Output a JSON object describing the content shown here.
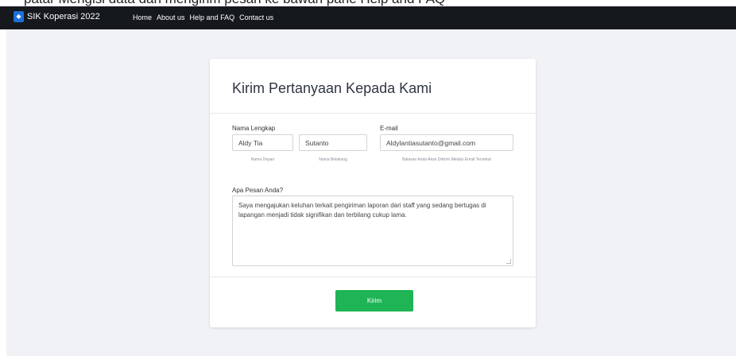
{
  "top_strip": {
    "text": "patar Mengisi data dan mengirim pesan ke bawah pane Help and FAQ"
  },
  "navbar": {
    "brand": "SIK Koperasi 2022",
    "links": [
      "Home",
      "About us",
      "Help and FAQ",
      "Contact us"
    ]
  },
  "form": {
    "title": "Kirim Pertanyaan Kepada Kami",
    "name_label": "Nama Lengkap",
    "first_name_value": "Aldy Tia",
    "last_name_value": "Sutanto",
    "first_name_hint": "Nama Depan",
    "last_name_hint": "Nama Belakang",
    "email_label": "E-mail",
    "email_value": "Aldylantiasutanto@gmail.com",
    "email_hint": "Balasan Anda Akan Dikirim Melalui Email Tersebut",
    "message_label": "Apa Pesan Anda?",
    "message_value": "Saya mengajukan keluhan terkait pengiriman laporan dari staff yang sedang bertugas di lapangan menjadi tidak signifikan dan terbilang cukup lama.",
    "submit_label": "Kirim"
  },
  "colors": {
    "navbar_bg": "#15181d",
    "page_bg": "#f1f2f5",
    "submit_bg": "#1fb455",
    "brand_logo": "#1e6fd9"
  }
}
